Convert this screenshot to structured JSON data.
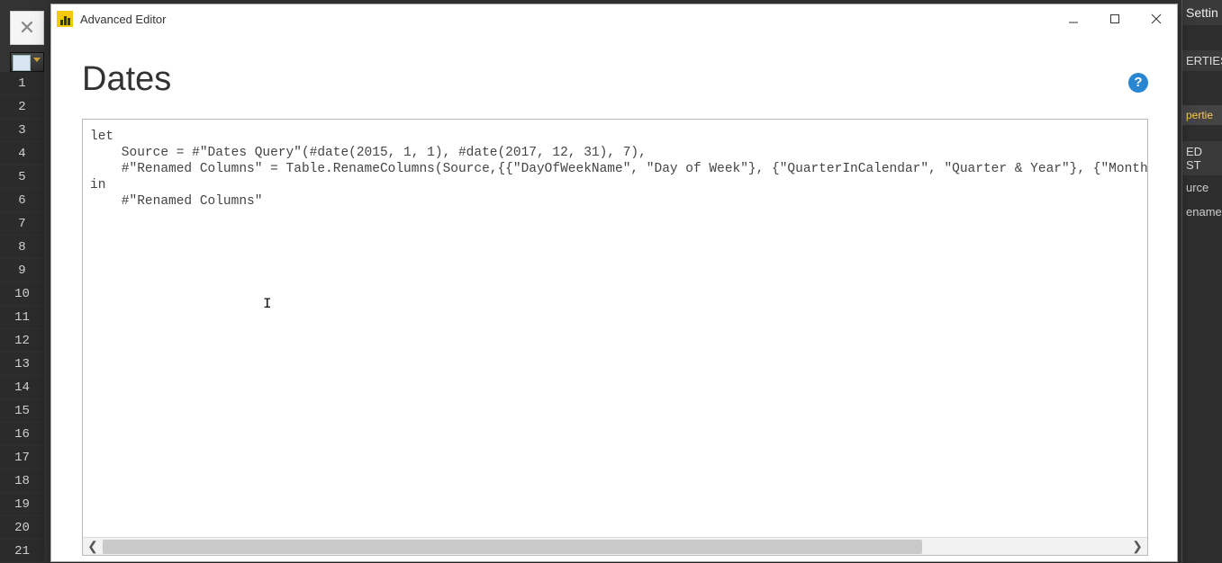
{
  "background": {
    "gutter_lines": [
      "1",
      "2",
      "3",
      "4",
      "5",
      "6",
      "7",
      "8",
      "9",
      "10",
      "11",
      "12",
      "13",
      "14",
      "15",
      "16",
      "17",
      "18",
      "19",
      "20",
      "21"
    ],
    "right_panel": {
      "settings": "Settin",
      "properties": "ERTIES",
      "link": "pertie",
      "applied_steps": "ED ST",
      "step1": "urce",
      "step2": "ename"
    }
  },
  "dialog": {
    "window_title": "Advanced Editor",
    "heading": "Dates",
    "help_glyph": "?",
    "code": "let\n    Source = #\"Dates Query\"(#date(2015, 1, 1), #date(2017, 12, 31), 7),\n    #\"Renamed Columns\" = Table.RenameColumns(Source,{{\"DayOfWeekName\", \"Day of Week\"}, {\"QuarterInCalendar\", \"Quarter & Year\"}, {\"MonthInCalend\nin\n    #\"Renamed Columns\"",
    "scroll": {
      "left_glyph": "❮",
      "right_glyph": "❯"
    }
  }
}
